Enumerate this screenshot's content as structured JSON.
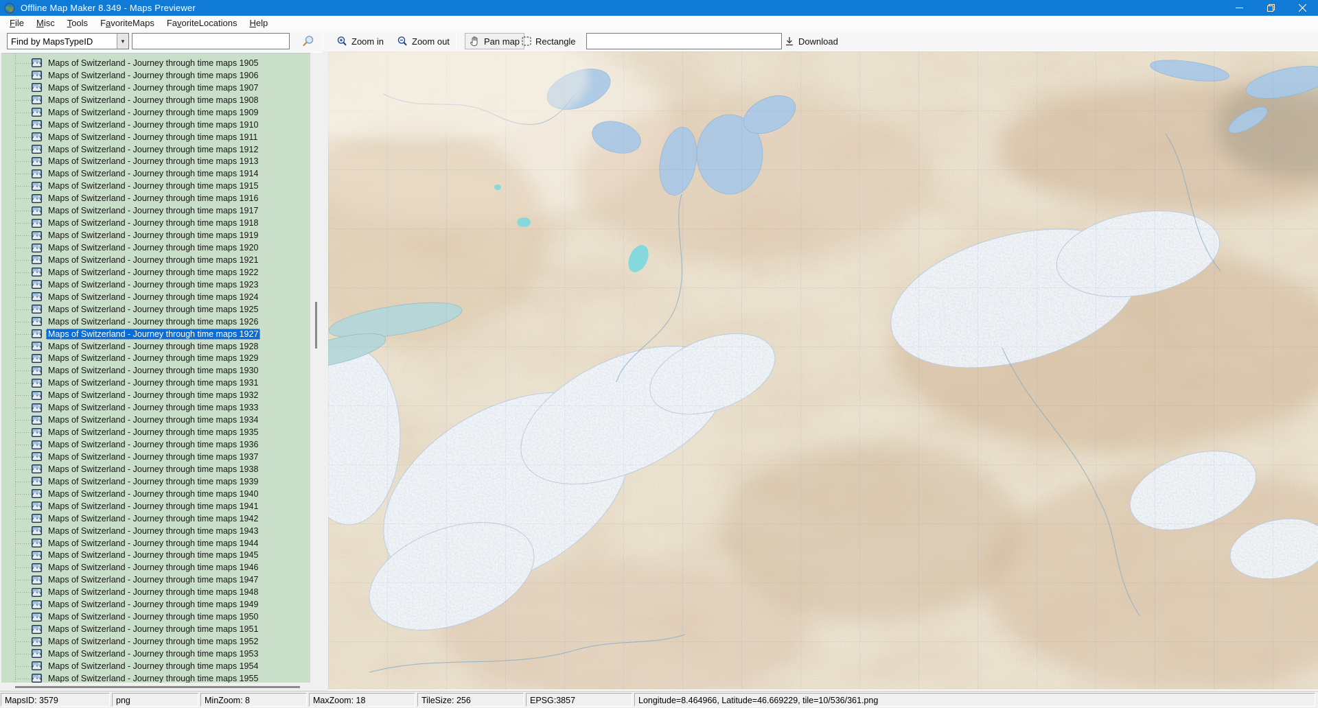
{
  "window": {
    "title": "Offline Map Maker 8.349 - Maps Previewer"
  },
  "titlebar_icons": {
    "app": "globe-map-icon",
    "minimize": "minimize-icon",
    "restore": "restore-icon",
    "close": "close-icon"
  },
  "menu": {
    "items": [
      {
        "pre": "",
        "accel": "F",
        "post": "ile"
      },
      {
        "pre": "",
        "accel": "M",
        "post": "isc"
      },
      {
        "pre": "",
        "accel": "T",
        "post": "ools"
      },
      {
        "pre": "F",
        "accel": "a",
        "post": "voriteMaps"
      },
      {
        "pre": "Fa",
        "accel": "v",
        "post": "oriteLocations"
      },
      {
        "pre": "",
        "accel": "H",
        "post": "elp"
      }
    ]
  },
  "search": {
    "filter_value": "Find by MapsTypeID",
    "query_value": "",
    "query_placeholder": ""
  },
  "map_toolbar": {
    "zoom_in_label": "Zoom in",
    "zoom_out_label": "Zoom out",
    "pan_label": "Pan map",
    "rectangle_label": "Rectangle",
    "active_tool": "Pan map",
    "input_value": "",
    "download_label": "Download"
  },
  "map_list": {
    "selected_index": 22,
    "items": [
      "Maps of Switzerland - Journey through time maps 1905",
      "Maps of Switzerland - Journey through time maps 1906",
      "Maps of Switzerland - Journey through time maps 1907",
      "Maps of Switzerland - Journey through time maps 1908",
      "Maps of Switzerland - Journey through time maps 1909",
      "Maps of Switzerland - Journey through time maps 1910",
      "Maps of Switzerland - Journey through time maps 1911",
      "Maps of Switzerland - Journey through time maps 1912",
      "Maps of Switzerland - Journey through time maps 1913",
      "Maps of Switzerland - Journey through time maps 1914",
      "Maps of Switzerland - Journey through time maps 1915",
      "Maps of Switzerland - Journey through time maps 1916",
      "Maps of Switzerland - Journey through time maps 1917",
      "Maps of Switzerland - Journey through time maps 1918",
      "Maps of Switzerland - Journey through time maps 1919",
      "Maps of Switzerland - Journey through time maps 1920",
      "Maps of Switzerland - Journey through time maps 1921",
      "Maps of Switzerland - Journey through time maps 1922",
      "Maps of Switzerland - Journey through time maps 1923",
      "Maps of Switzerland - Journey through time maps 1924",
      "Maps of Switzerland - Journey through time maps 1925",
      "Maps of Switzerland - Journey through time maps 1926",
      "Maps of Switzerland - Journey through time maps 1927",
      "Maps of Switzerland - Journey through time maps 1928",
      "Maps of Switzerland - Journey through time maps 1929",
      "Maps of Switzerland - Journey through time maps 1930",
      "Maps of Switzerland - Journey through time maps 1931",
      "Maps of Switzerland - Journey through time maps 1932",
      "Maps of Switzerland - Journey through time maps 1933",
      "Maps of Switzerland - Journey through time maps 1934",
      "Maps of Switzerland - Journey through time maps 1935",
      "Maps of Switzerland - Journey through time maps 1936",
      "Maps of Switzerland - Journey through time maps 1937",
      "Maps of Switzerland - Journey through time maps 1938",
      "Maps of Switzerland - Journey through time maps 1939",
      "Maps of Switzerland - Journey through time maps 1940",
      "Maps of Switzerland - Journey through time maps 1941",
      "Maps of Switzerland - Journey through time maps 1942",
      "Maps of Switzerland - Journey through time maps 1943",
      "Maps of Switzerland - Journey through time maps 1944",
      "Maps of Switzerland - Journey through time maps 1945",
      "Maps of Switzerland - Journey through time maps 1946",
      "Maps of Switzerland - Journey through time maps 1947",
      "Maps of Switzerland - Journey through time maps 1948",
      "Maps of Switzerland - Journey through time maps 1949",
      "Maps of Switzerland - Journey through time maps 1950",
      "Maps of Switzerland - Journey through time maps 1951",
      "Maps of Switzerland - Journey through time maps 1952",
      "Maps of Switzerland - Journey through time maps 1953",
      "Maps of Switzerland - Journey through time maps 1954",
      "Maps of Switzerland - Journey through time maps 1955"
    ],
    "item_icon": "map-image-icon"
  },
  "statusbar": {
    "panels": [
      {
        "name": "maps-id",
        "text": "MapsID: 3579"
      },
      {
        "name": "format",
        "text": "png"
      },
      {
        "name": "min-zoom",
        "text": "MinZoom: 8"
      },
      {
        "name": "max-zoom",
        "text": "MaxZoom: 18"
      },
      {
        "name": "tile-size",
        "text": "TileSize: 256"
      },
      {
        "name": "epsg",
        "text": "EPSG:3857"
      },
      {
        "name": "coordinates",
        "text": "Longitude=8.464966, Latitude=46.669229, tile=10/536/361.png"
      }
    ]
  },
  "colors": {
    "titlebar": "#0f7bd7",
    "selection": "#0a6cd6",
    "tree_background": "#c9dfc9",
    "map_base": "#ece4d2",
    "lake": "#a9c8e6",
    "lake_bright": "#7fd9dd",
    "glacier": "#f2f6fa"
  }
}
